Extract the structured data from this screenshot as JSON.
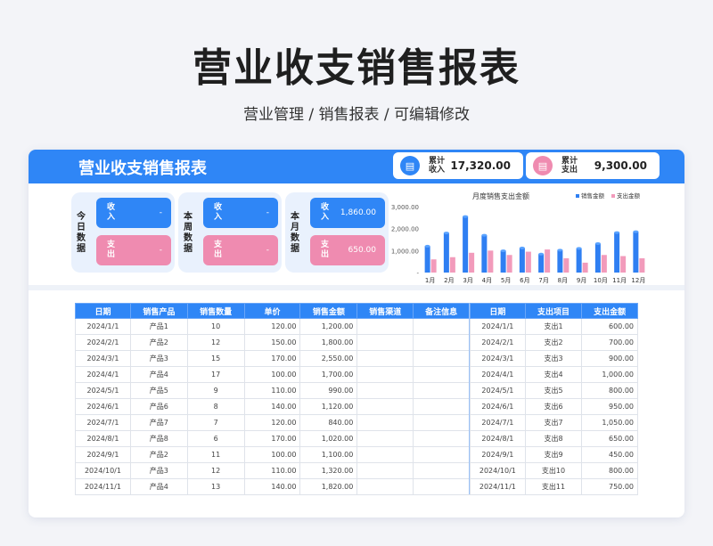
{
  "hero": {
    "title": "营业收支销售报表",
    "subtitle": "营业管理 / 销售报表 / 可编辑修改"
  },
  "card": {
    "title": "营业收支销售报表",
    "total_income": {
      "label": "累计收入",
      "value": "17,320.00"
    },
    "total_expense": {
      "label": "累计支出",
      "value": "9,300.00"
    }
  },
  "kpis": [
    {
      "label": "今日数据",
      "income_label": "收入",
      "income_value": "-",
      "expense_label": "支出",
      "expense_value": "-"
    },
    {
      "label": "本周数据",
      "income_label": "收入",
      "income_value": "-",
      "expense_label": "支出",
      "expense_value": "-"
    },
    {
      "label": "本月数据",
      "income_label": "收入",
      "income_value": "1,860.00",
      "expense_label": "支出",
      "expense_value": "650.00"
    }
  ],
  "colors": {
    "accent": "#2f86f6",
    "pink": "#ef8bb0",
    "bar_sales": "#2f7ff2",
    "bar_expense": "#f29bbb"
  },
  "chart_data": {
    "type": "bar",
    "title": "月度销售支出金额",
    "categories": [
      "1月",
      "2月",
      "3月",
      "4月",
      "5月",
      "6月",
      "7月",
      "8月",
      "9月",
      "10月",
      "11月",
      "12月"
    ],
    "series": [
      {
        "name": "销售金额",
        "values": [
          1200,
          1800,
          2550,
          1700,
          990,
          1120,
          840,
          1020,
          1100,
          1320,
          1820,
          1860
        ]
      },
      {
        "name": "支出金额",
        "values": [
          600,
          700,
          900,
          1000,
          800,
          950,
          1050,
          650,
          450,
          800,
          750,
          650
        ]
      }
    ],
    "ylim": [
      0,
      3000
    ],
    "yticks": [
      "3,000.00",
      "2,000.00",
      "1,000.00",
      "-"
    ],
    "ytick_values": [
      3000,
      2000,
      1000,
      0
    ],
    "legend": "top-right"
  },
  "sales_table": {
    "headers": [
      "日期",
      "销售产品",
      "销售数量",
      "单价",
      "销售金额",
      "销售渠道",
      "备注信息"
    ],
    "rows": [
      [
        "2024/1/1",
        "产品1",
        "10",
        "120.00",
        "1,200.00",
        "",
        ""
      ],
      [
        "2024/2/1",
        "产品2",
        "12",
        "150.00",
        "1,800.00",
        "",
        ""
      ],
      [
        "2024/3/1",
        "产品3",
        "15",
        "170.00",
        "2,550.00",
        "",
        ""
      ],
      [
        "2024/4/1",
        "产品4",
        "17",
        "100.00",
        "1,700.00",
        "",
        ""
      ],
      [
        "2024/5/1",
        "产品5",
        "9",
        "110.00",
        "990.00",
        "",
        ""
      ],
      [
        "2024/6/1",
        "产品6",
        "8",
        "140.00",
        "1,120.00",
        "",
        ""
      ],
      [
        "2024/7/1",
        "产品7",
        "7",
        "120.00",
        "840.00",
        "",
        ""
      ],
      [
        "2024/8/1",
        "产品8",
        "6",
        "170.00",
        "1,020.00",
        "",
        ""
      ],
      [
        "2024/9/1",
        "产品2",
        "11",
        "100.00",
        "1,100.00",
        "",
        ""
      ],
      [
        "2024/10/1",
        "产品3",
        "12",
        "110.00",
        "1,320.00",
        "",
        ""
      ],
      [
        "2024/11/1",
        "产品4",
        "13",
        "140.00",
        "1,820.00",
        "",
        ""
      ]
    ]
  },
  "expense_table": {
    "headers": [
      "日期",
      "支出项目",
      "支出金额"
    ],
    "rows": [
      [
        "2024/1/1",
        "支出1",
        "600.00"
      ],
      [
        "2024/2/1",
        "支出2",
        "700.00"
      ],
      [
        "2024/3/1",
        "支出3",
        "900.00"
      ],
      [
        "2024/4/1",
        "支出4",
        "1,000.00"
      ],
      [
        "2024/5/1",
        "支出5",
        "800.00"
      ],
      [
        "2024/6/1",
        "支出6",
        "950.00"
      ],
      [
        "2024/7/1",
        "支出7",
        "1,050.00"
      ],
      [
        "2024/8/1",
        "支出8",
        "650.00"
      ],
      [
        "2024/9/1",
        "支出9",
        "450.00"
      ],
      [
        "2024/10/1",
        "支出10",
        "800.00"
      ],
      [
        "2024/11/1",
        "支出11",
        "750.00"
      ]
    ]
  }
}
